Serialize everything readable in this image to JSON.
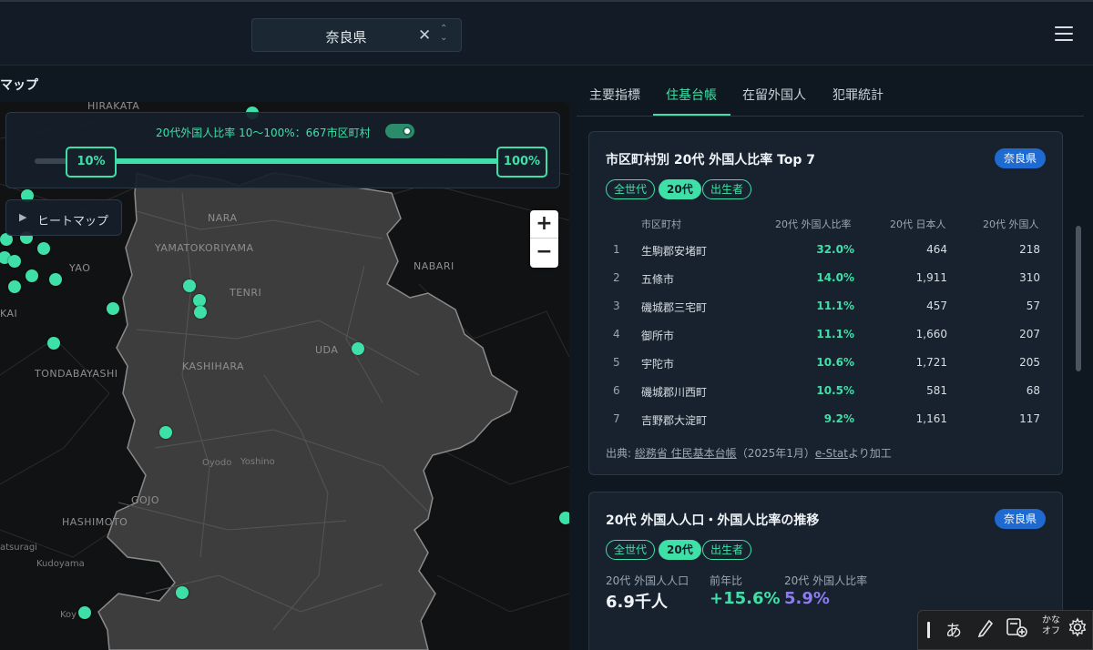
{
  "header": {
    "prefecture_select": "奈良県",
    "clear_icon": "✕",
    "updown_icon": "⌃⌄"
  },
  "map": {
    "title": "マップ",
    "filter_text": "20代外国人比率 10〜100%：667市区町村",
    "slider_min_label": "10%",
    "slider_max_label": "100%",
    "slider_range": {
      "min": 10,
      "max": 100
    },
    "heatmap_label": "ヒートマップ",
    "zoom_in": "+",
    "zoom_out": "−",
    "labels": {
      "hirakata": "HIRAKATA",
      "nara": "NARA",
      "yamatokoriyama": "YAMATOKORIYAMA",
      "yao": "YAO",
      "tenri": "TENRI",
      "nabari": "NABARI",
      "kai": "KAI",
      "uda": "UDA",
      "tondabayashi": "TONDABAYASHI",
      "kashihara": "KASHIHARA",
      "oyodo": "Oyodo",
      "yoshino": "Yoshino",
      "gojo": "GOJO",
      "hashimoto": "HASHIMOTO",
      "katsuragi": "atsuragi",
      "kudoyama": "Kudoyama",
      "koya": "Koy"
    }
  },
  "tabs": [
    "主要指標",
    "住基台帳",
    "在留外国人",
    "犯罪統計"
  ],
  "active_tab": "住基台帳",
  "card1": {
    "title": "市区町村別 20代 外国人比率 Top 7",
    "badge": "奈良県",
    "chips": [
      "全世代",
      "20代",
      "出生者"
    ],
    "columns": [
      "市区町村",
      "20代 外国人比率",
      "20代 日本人",
      "20代 外国人"
    ],
    "rows": [
      {
        "rank": "1",
        "name": "生駒郡安堵町",
        "ratio": "32.0%",
        "jp": "464",
        "fr": "218"
      },
      {
        "rank": "2",
        "name": "五條市",
        "ratio": "14.0%",
        "jp": "1,911",
        "fr": "310"
      },
      {
        "rank": "3",
        "name": "磯城郡三宅町",
        "ratio": "11.1%",
        "jp": "457",
        "fr": "57"
      },
      {
        "rank": "4",
        "name": "御所市",
        "ratio": "11.1%",
        "jp": "1,660",
        "fr": "207"
      },
      {
        "rank": "5",
        "name": "宇陀市",
        "ratio": "10.6%",
        "jp": "1,721",
        "fr": "205"
      },
      {
        "rank": "6",
        "name": "磯城郡川西町",
        "ratio": "10.5%",
        "jp": "581",
        "fr": "68"
      },
      {
        "rank": "7",
        "name": "吉野郡大淀町",
        "ratio": "9.2%",
        "jp": "1,161",
        "fr": "117"
      }
    ],
    "source_prefix": "出典: ",
    "source_link1": "総務省 住民基本台帳",
    "source_mid": "（2025年1月）",
    "source_link2": "e-Stat",
    "source_suffix": "より加工"
  },
  "card2": {
    "title": "20代 外国人人口・外国人比率の推移",
    "badge": "奈良県",
    "chips": [
      "全世代",
      "20代",
      "出生者"
    ],
    "stats": [
      {
        "label": "20代 外国人人口",
        "value": "6.9千人",
        "color": "#f0f4f8"
      },
      {
        "label": "前年比",
        "value": "+15.6%",
        "color": "#3ee0a8"
      },
      {
        "label": "20代 外国人比率",
        "value": "5.9%",
        "color": "#8c7cf0"
      }
    ]
  },
  "ime": {
    "hira": "あ",
    "kana_top": "かな",
    "kana_bottom": "オフ"
  },
  "colors": {
    "accent": "#3ee0a8",
    "badge": "#1f6ad1",
    "ratio_purple": "#8c7cf0"
  }
}
